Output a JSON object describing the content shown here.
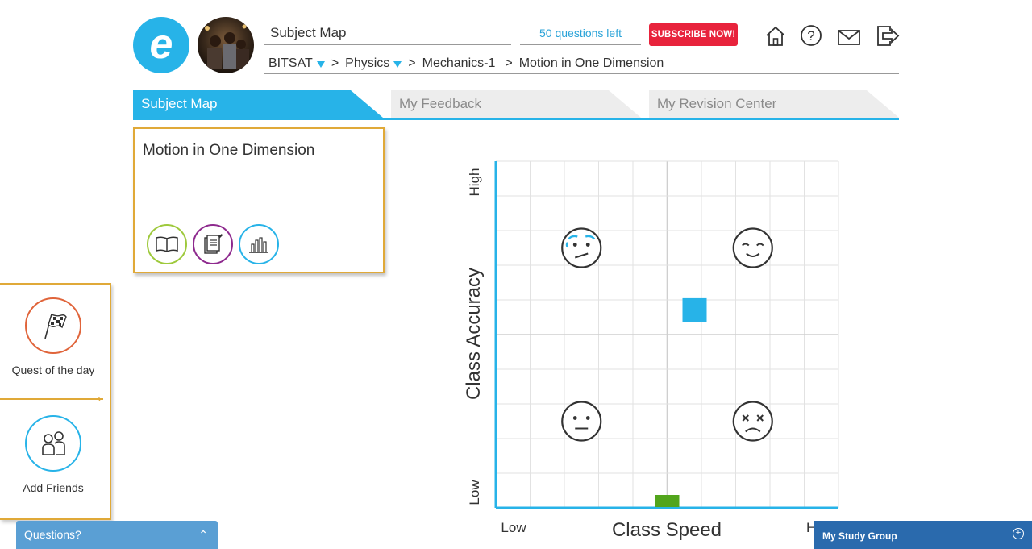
{
  "header": {
    "logo_letter": "e",
    "page_title": "Subject Map",
    "questions_left": "50 questions left",
    "subscribe_label": "SUBSCRIBE NOW!",
    "icons": [
      "home-icon",
      "help-icon",
      "mail-icon",
      "logout-icon"
    ]
  },
  "breadcrumb": {
    "items": [
      "BITSAT",
      "Physics",
      "Mechanics-1",
      "Motion in One Dimension"
    ],
    "separator": ">"
  },
  "tabs": [
    {
      "label": "Subject Map",
      "active": true
    },
    {
      "label": "My Feedback",
      "active": false
    },
    {
      "label": "My Revision Center",
      "active": false
    }
  ],
  "topic_card": {
    "title": "Motion in One Dimension",
    "buttons": [
      {
        "icon": "book-icon",
        "color": "#9ec93c"
      },
      {
        "icon": "notes-icon",
        "color": "#8e2a8e"
      },
      {
        "icon": "bar-chart-icon",
        "color": "#27b3e8"
      }
    ]
  },
  "side_panel": {
    "quest_label": "Quest of the day",
    "friends_label": "Add Friends",
    "quest_color": "#e0643a",
    "friends_color": "#27b3e8"
  },
  "chart_data": {
    "type": "scatter",
    "xlabel": "Class Speed",
    "ylabel": "Class Accuracy",
    "x_tick_labels": [
      "Low",
      "H"
    ],
    "y_tick_labels": [
      "Low",
      "High"
    ],
    "quadrant_faces": [
      "worried-face-icon",
      "happy-face-icon",
      "neutral-face-icon",
      "sad-face-icon"
    ],
    "points": [
      {
        "name": "blue-square",
        "x": 0.58,
        "y": 0.57,
        "color": "#27b3e8"
      },
      {
        "name": "green-marker",
        "x": 0.5,
        "y": 0.0,
        "color": "#52a51c"
      }
    ],
    "grid": true,
    "xlim": [
      0,
      1
    ],
    "ylim": [
      0,
      1
    ]
  },
  "bottom": {
    "questions_label": "Questions?",
    "study_group_label": "My Study Group"
  },
  "colors": {
    "accent": "#27b3e8",
    "card_border": "#e0a938",
    "subscribe": "#e8233c"
  }
}
